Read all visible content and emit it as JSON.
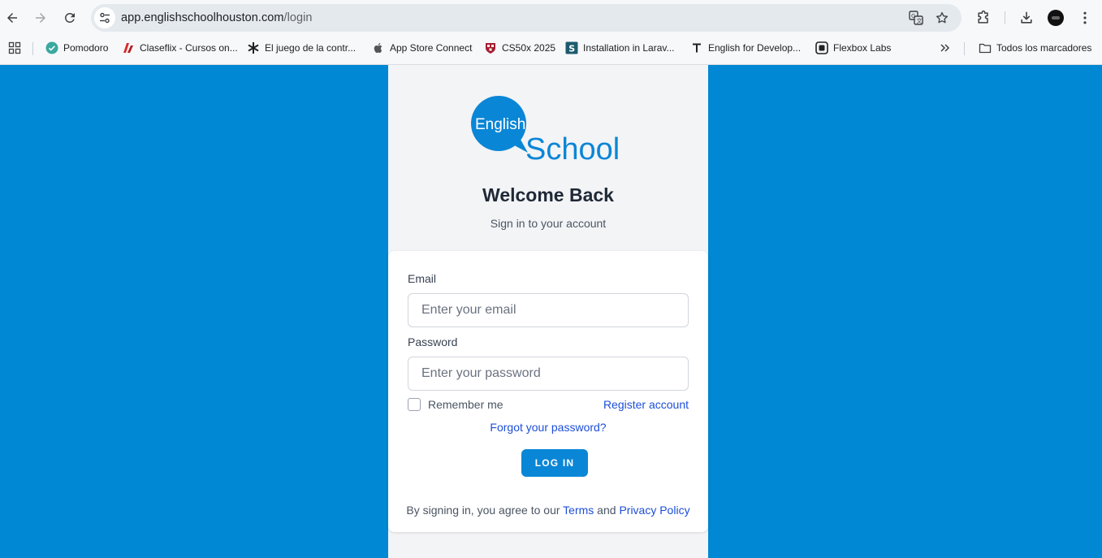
{
  "browser": {
    "url_host": "app.englishschoolhouston.com",
    "url_path": "/login",
    "bookmarks": [
      {
        "label": "Pomodoro",
        "icon": "check-circle-icon"
      },
      {
        "label": "Claseflix - Cursos on...",
        "icon": "claseflix-icon"
      },
      {
        "label": "El juego de la contr...",
        "icon": "asterisk-icon"
      },
      {
        "label": "App Store Connect",
        "icon": "apple-icon"
      },
      {
        "label": "CS50x 2025",
        "icon": "harvard-shield-icon"
      },
      {
        "label": "Installation in Larav...",
        "icon": "s-square-icon"
      },
      {
        "label": "English for Develop...",
        "icon": "t-icon"
      },
      {
        "label": "Flexbox Labs",
        "icon": "flexbox-icon"
      }
    ],
    "all_bookmarks_label": "Todos los marcadores"
  },
  "logo": {
    "english": "English",
    "school": "School"
  },
  "header": {
    "title": "Welcome Back",
    "subtitle": "Sign in to your account"
  },
  "form": {
    "email_label": "Email",
    "email_placeholder": "Enter your email",
    "password_label": "Password",
    "password_placeholder": "Enter your password",
    "remember_label": "Remember me",
    "register_link": "Register account",
    "forgot_link": "Forgot your password?",
    "login_button": "LOG IN"
  },
  "footer": {
    "prefix": "By signing in, you agree to our ",
    "terms_link": "Terms",
    "and": " and ",
    "privacy_link": "Privacy Policy"
  },
  "colors": {
    "page_background": "#0088d4",
    "brand": "#0a86d6",
    "link": "#1d4ed8"
  }
}
